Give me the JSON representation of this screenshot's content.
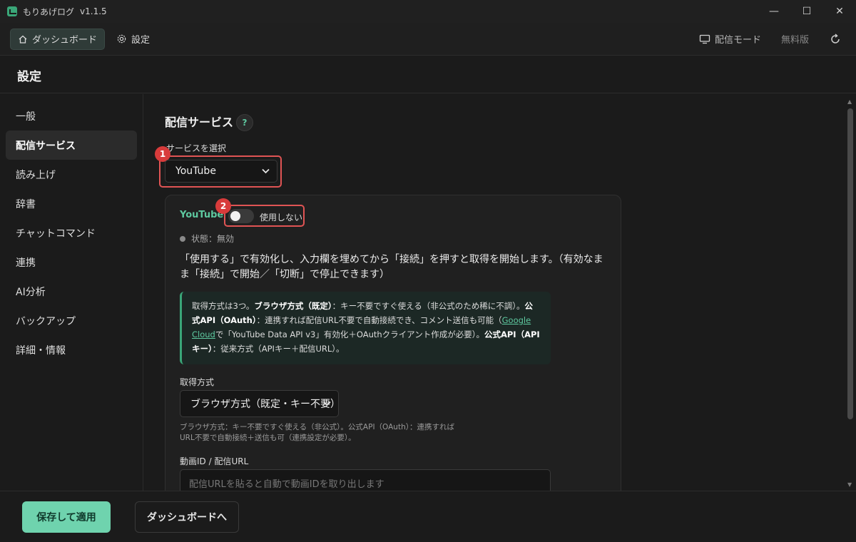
{
  "app": {
    "title": "もりあげログ",
    "version": "v1.1.5"
  },
  "window_controls": {
    "minimize": "—",
    "maximize": "☐",
    "close": "✕"
  },
  "topnav": {
    "dashboard": "ダッシュボード",
    "settings": "設定",
    "stream_mode": "配信モード",
    "plan": "無料版"
  },
  "page": {
    "title": "設定"
  },
  "sidebar": {
    "items": [
      {
        "label": "一般"
      },
      {
        "label": "配信サービス"
      },
      {
        "label": "読み上げ"
      },
      {
        "label": "辞書"
      },
      {
        "label": "チャットコマンド"
      },
      {
        "label": "連携"
      },
      {
        "label": "AI分析"
      },
      {
        "label": "バックアップ"
      },
      {
        "label": "詳細・情報"
      }
    ]
  },
  "main": {
    "section_title": "配信サービス",
    "help": "?",
    "service_label": "サービスを選択",
    "service_value": "YouTube",
    "annotations": [
      "1",
      "2"
    ],
    "card": {
      "service_name": "YouTube",
      "toggle_label": "使用しない",
      "status": "状態：無効",
      "description": "「使用する」で有効化し、入力欄を埋めてから「接続」を押すと取得を開始します。（有効なまま「接続」で開始／「切断」で停止できます）",
      "info": {
        "p1": "取得方式は3つ。",
        "b1": "ブラウザ方式（既定）",
        "p2": "：キー不要ですぐ使える（非公式のため稀に不調）。",
        "b2": "公式API（OAuth）",
        "p3": "：連携すれば配信URL不要で自動接続でき、コメント送信も可能（",
        "link": "Google Cloud",
        "p4": "で「YouTube Data API v3」有効化＋OAuthクライアント作成が必要）。",
        "b3": "公式API（APIキー）",
        "p5": "：従来方式（APIキー＋配信URL）。"
      },
      "method_label": "取得方式",
      "method_value": "ブラウザ方式（既定・キー不要）",
      "method_hint": "ブラウザ方式：キー不要ですぐ使える（非公式）。公式API（OAuth）：連携すればURL不要で自動接続＋送信も可（連携設定が必要）。",
      "video_label": "動画ID / 配信URL",
      "video_placeholder": "配信URLを貼ると自動で動画IDを取り出します"
    }
  },
  "footer": {
    "save": "保存して適用",
    "to_dashboard": "ダッシュボードへ"
  },
  "colors": {
    "accent": "#5ec9a0",
    "primary_button": "#6fd3ae",
    "annotation": "#e05454"
  }
}
